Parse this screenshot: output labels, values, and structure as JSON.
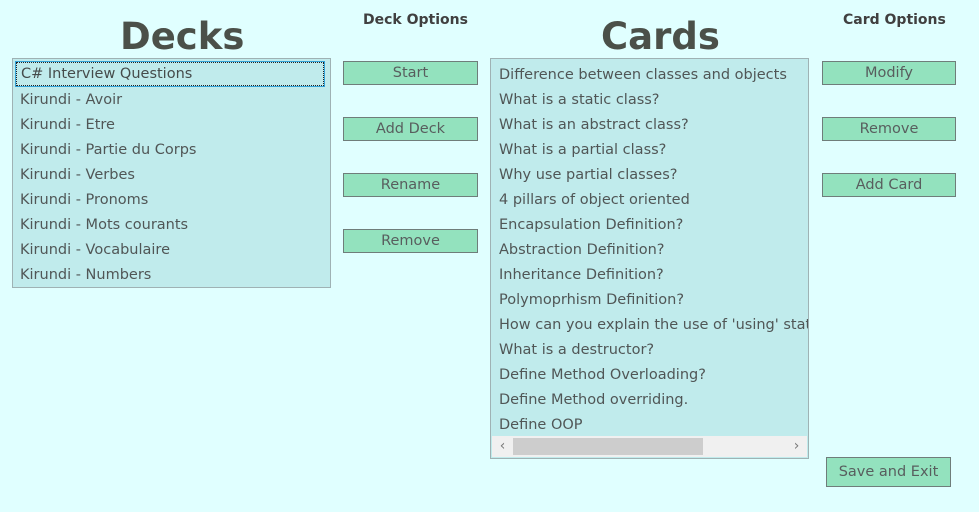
{
  "decks": {
    "title": "Decks",
    "options_title": "Deck Options",
    "items": [
      "C# Interview Questions",
      "Kirundi - Avoir",
      "Kirundi - Etre",
      "Kirundi - Partie du Corps",
      "Kirundi - Verbes",
      "Kirundi - Pronoms",
      "Kirundi - Mots courants",
      "Kirundi - Vocabulaire",
      "Kirundi - Numbers"
    ],
    "selected": "C# Interview Questions",
    "buttons": {
      "start": "Start",
      "add": "Add Deck",
      "rename": "Rename",
      "remove": "Remove"
    }
  },
  "cards": {
    "title": "Cards",
    "options_title": "Card Options",
    "items": [
      "Difference between classes and objects",
      "What is a static class?",
      "What is an abstract class?",
      "What is a partial class?",
      "Why use partial classes?",
      "4 pillars of object oriented",
      "Encapsulation Definition?",
      "Abstraction Definition?",
      "Inheritance Definition?",
      "Polymoprhism Definition?",
      "How can you explain the use of 'using' stateme",
      "What is a destructor?",
      "Define Method Overloading?",
      "Define Method overriding.",
      "Define OOP"
    ],
    "buttons": {
      "modify": "Modify",
      "remove": "Remove",
      "add": "Add Card"
    }
  },
  "footer": {
    "save_exit": "Save and Exit"
  },
  "icons": {
    "scroll_left": "chevron-left-icon",
    "scroll_right": "chevron-right-icon"
  },
  "colors": {
    "background": "#e0ffff",
    "list_background": "#c0ebec",
    "button_background": "#93e2be",
    "title_text": "#4b5049"
  }
}
